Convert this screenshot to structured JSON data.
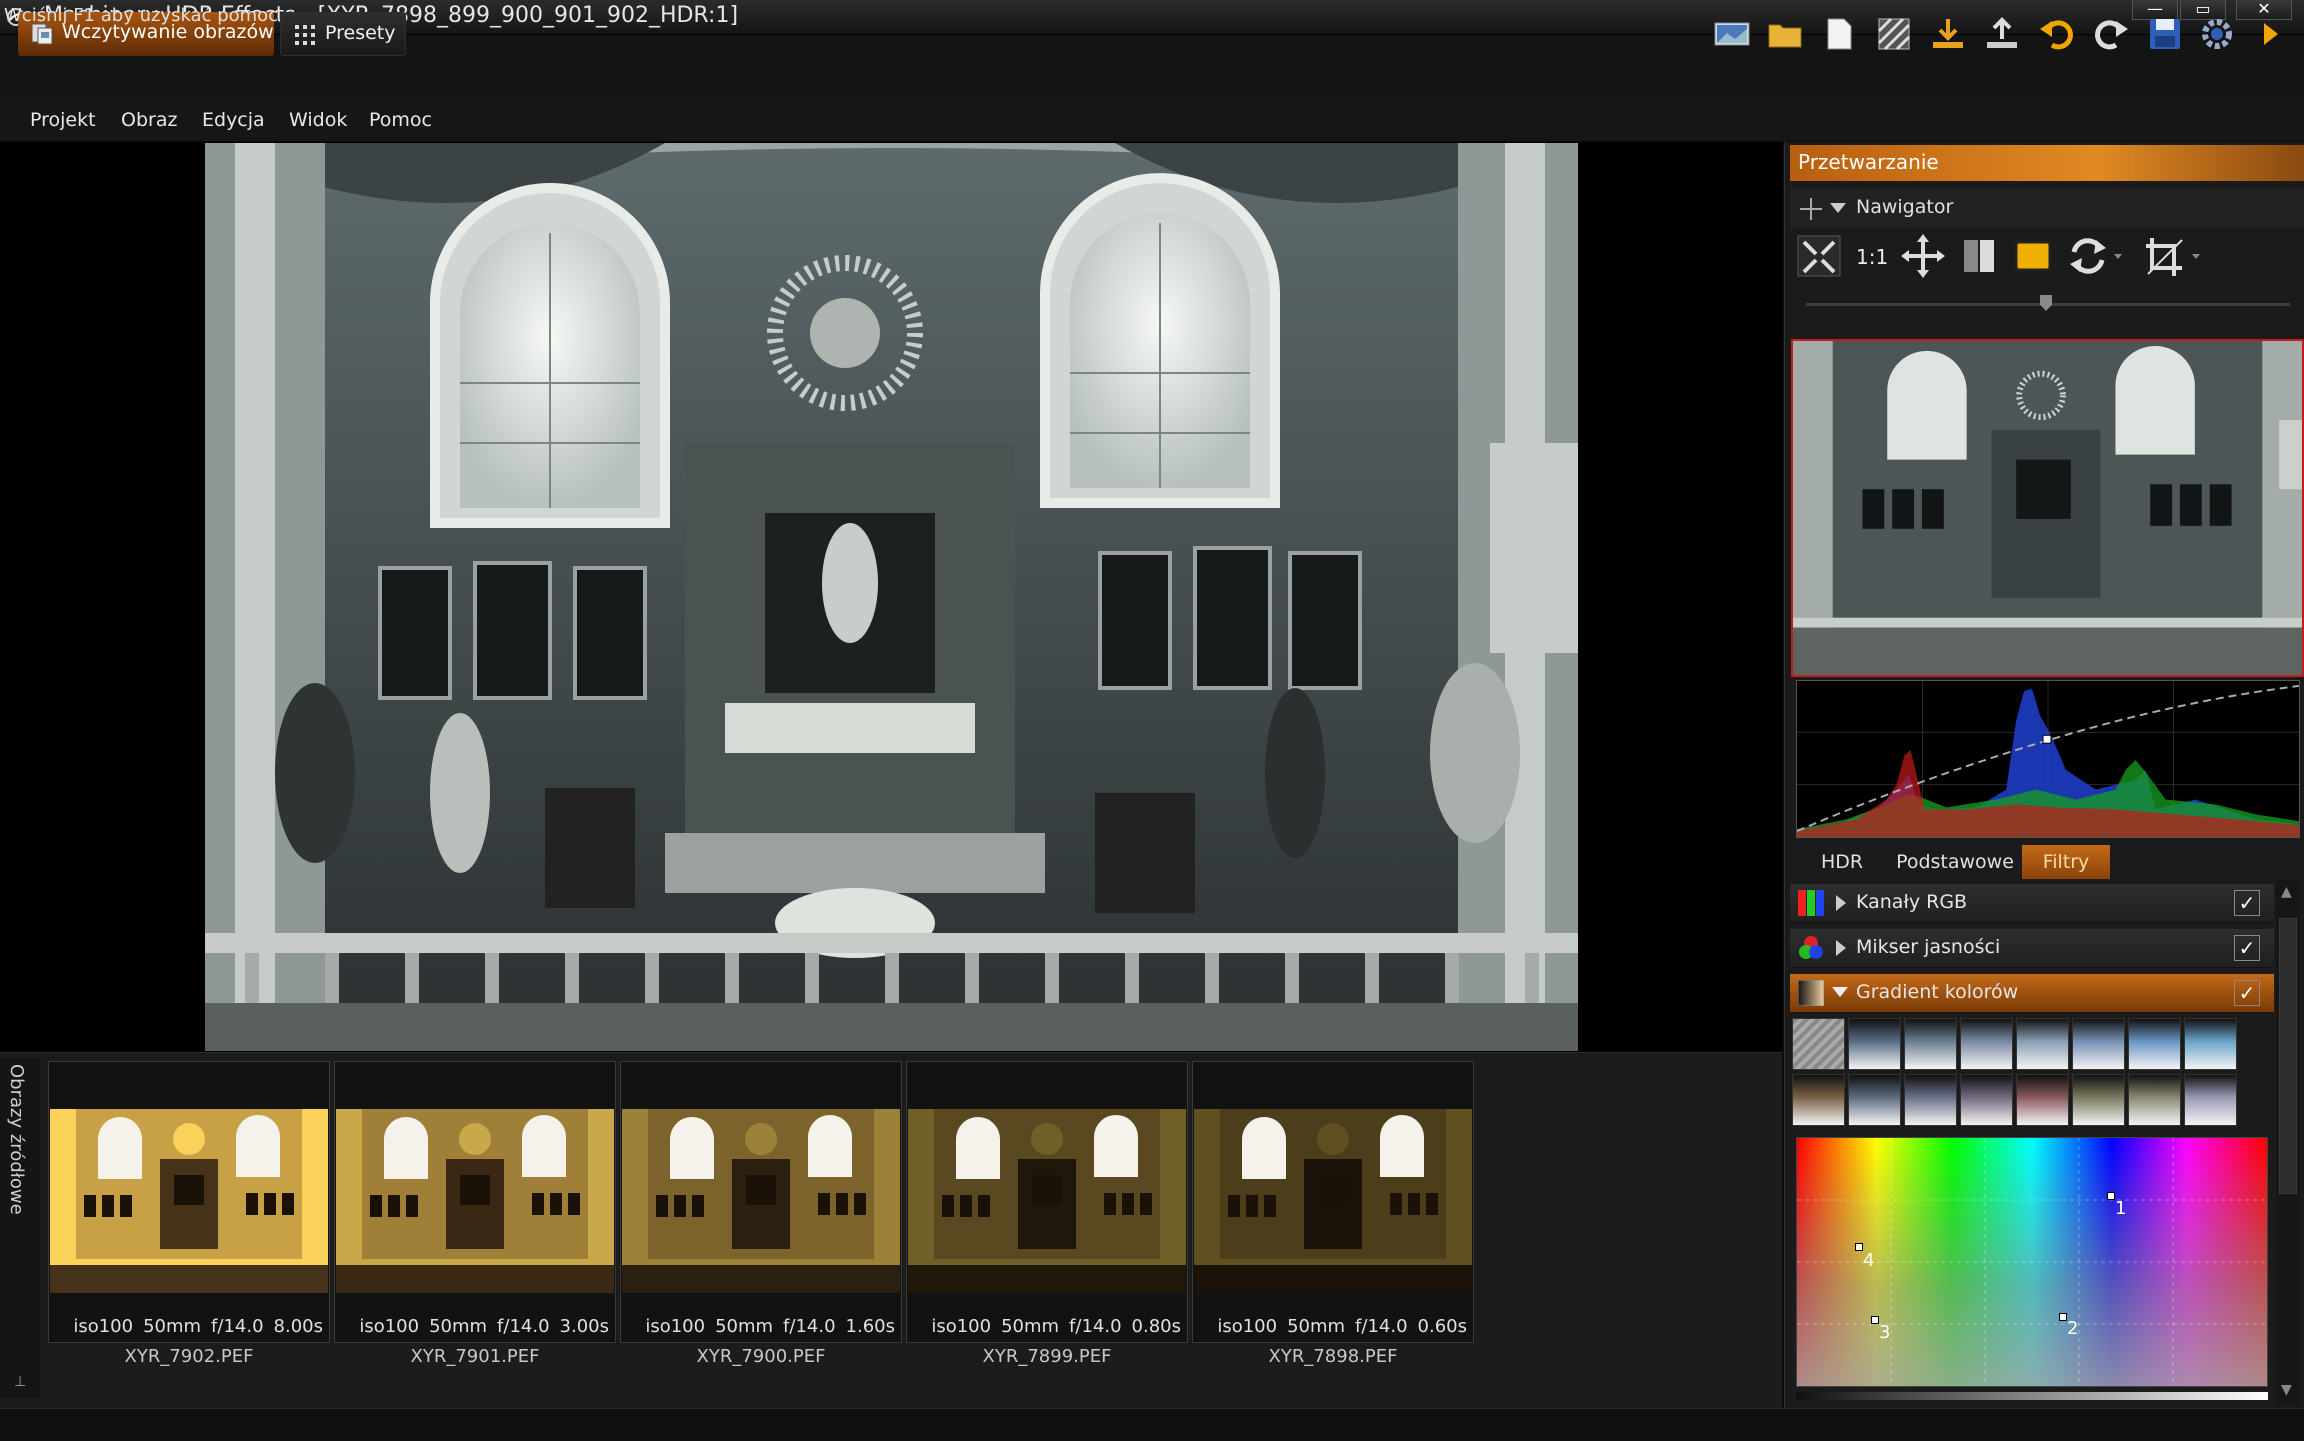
{
  "window": {
    "title": "Machinery HDR Effects - [XYR_7898_899_900_901_902_HDR:1]",
    "minimize": "—",
    "maximize": "▭",
    "close": "✕"
  },
  "toolbar": {
    "load_tab": "Wczytywanie obrazów",
    "presets_tab": "Presety",
    "icons": [
      "image-icon",
      "open-folder-icon",
      "new-document-icon",
      "texture-icon",
      "import-icon",
      "export-icon",
      "undo-icon",
      "redo-icon",
      "save-icon",
      "settings-icon",
      "next-arrow-icon"
    ]
  },
  "menu": [
    "Projekt",
    "Obraz",
    "Edycja",
    "Widok",
    "Pomoc"
  ],
  "filmstrip": {
    "label": "Obrazy źródłowe",
    "thumbs": [
      {
        "iso": "iso100",
        "focal": "50mm",
        "aperture": "f/14.0",
        "shutter": "8.00s",
        "file": "XYR_7902.PEF",
        "brightness": 1.0
      },
      {
        "iso": "iso100",
        "focal": "50mm",
        "aperture": "f/14.0",
        "shutter": "3.00s",
        "file": "XYR_7901.PEF",
        "brightness": 0.8
      },
      {
        "iso": "iso100",
        "focal": "50mm",
        "aperture": "f/14.0",
        "shutter": "1.60s",
        "file": "XYR_7900.PEF",
        "brightness": 0.62
      },
      {
        "iso": "iso100",
        "focal": "50mm",
        "aperture": "f/14.0",
        "shutter": "0.80s",
        "file": "XYR_7899.PEF",
        "brightness": 0.45
      },
      {
        "iso": "iso100",
        "focal": "50mm",
        "aperture": "f/14.0",
        "shutter": "0.60s",
        "file": "XYR_7898.PEF",
        "brightness": 0.38
      }
    ]
  },
  "status": "Wciśnij F1 aby uzyskać pomoc",
  "panel": {
    "header": "Przetwarzanie",
    "navigator": "Nawigator",
    "zoom_label": "1:1",
    "zoom_level": 0.5,
    "tabs": [
      "HDR",
      "Podstawowe",
      "Filtry"
    ],
    "active_tab": "Filtry",
    "filters": [
      {
        "label": "Kanały RGB",
        "checked": true,
        "expanded": false
      },
      {
        "label": "Mikser jasności",
        "checked": true,
        "expanded": false
      },
      {
        "label": "Gradient kolorów",
        "checked": true,
        "expanded": true
      }
    ],
    "checkmark": "✓",
    "gradient_points": [
      "1",
      "2",
      "3",
      "4"
    ]
  },
  "colors": {
    "accent": "#c26a18",
    "highlight_border": "#c41b1b"
  }
}
